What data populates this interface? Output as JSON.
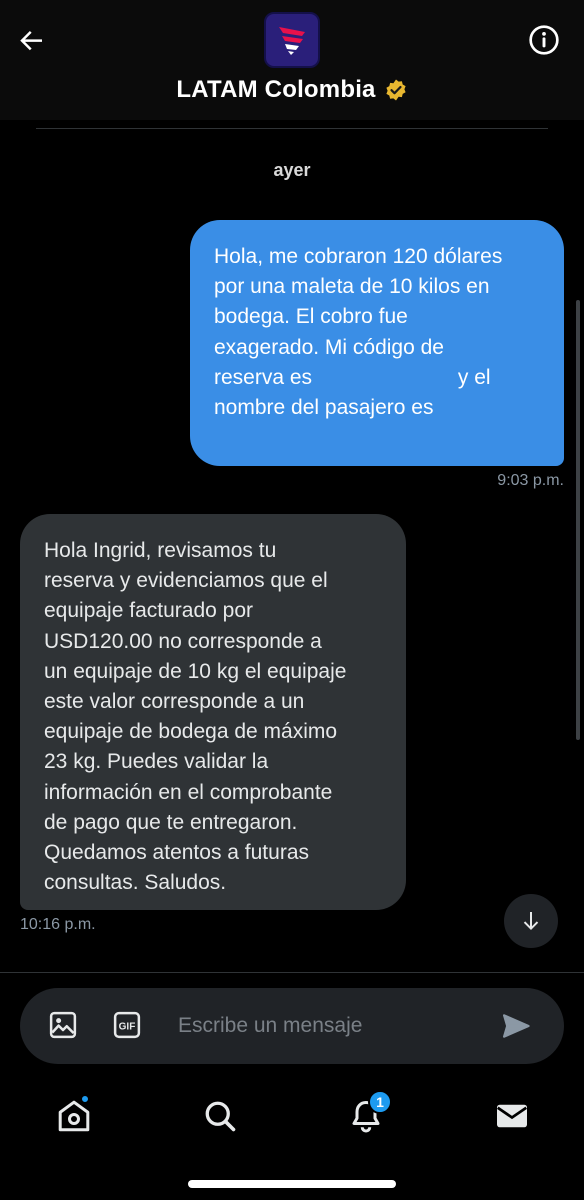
{
  "header": {
    "back_icon": "arrow-left-icon",
    "title": "LATAM Colombia",
    "verified_icon": "verified-badge-icon",
    "info_icon": "info-icon",
    "avatar_icon": "latam-logo-icon"
  },
  "conversation": {
    "date_label": "ayer",
    "messages": [
      {
        "direction": "outgoing",
        "text": "Hola, me cobraron 120 dólares\npor una maleta de 10 kilos en\nbodega. El cobro fue\nexagerado. Mi código de\nreserva es                         y el\nnombre del pasajero es",
        "time": "9:03 p.m."
      },
      {
        "direction": "incoming",
        "text": "Hola Ingrid, revisamos tu\nreserva y evidenciamos que el\nequipaje facturado por\nUSD120.00 no corresponde a\nun equipaje de 10 kg el equipaje\neste valor corresponde a un\nequipaje de bodega de máximo\n23 kg. Puedes validar la\ninformación en el comprobante\nde pago que te entregaron.\nQuedamos atentos a futuras\nconsultas. Saludos.",
        "time": "10:16 p.m."
      }
    ],
    "scroll_down_icon": "arrow-down-icon"
  },
  "composer": {
    "image_icon": "image-icon",
    "gif_icon": "gif-icon",
    "gif_label": "GIF",
    "placeholder": "Escribe un mensaje",
    "send_icon": "send-icon"
  },
  "nav": {
    "items": [
      {
        "name": "home",
        "icon": "home-icon",
        "has_dot": true
      },
      {
        "name": "search",
        "icon": "search-icon"
      },
      {
        "name": "notifications",
        "icon": "bell-icon",
        "badge": "1"
      },
      {
        "name": "messages",
        "icon": "mail-icon"
      }
    ]
  },
  "colors": {
    "outgoing_bubble": "#3a8ee6",
    "incoming_bubble": "#2f3336",
    "accent": "#1d9bf0",
    "verified_gold": "#e8b730",
    "background": "#000000"
  }
}
